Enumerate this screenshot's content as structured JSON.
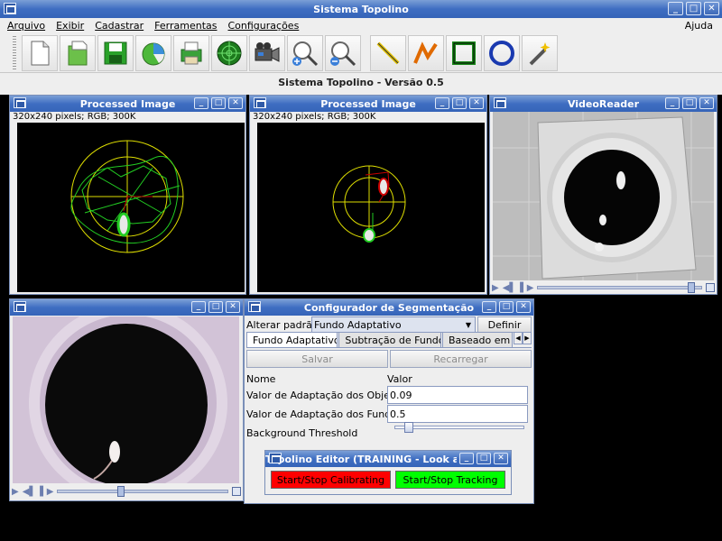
{
  "main": {
    "title": "Sistema Topolino",
    "status": "Sistema Topolino - Versão 0.5",
    "menu": [
      "Arquivo",
      "Exibir",
      "Cadastrar",
      "Ferramentas",
      "Configurações"
    ],
    "help": "Ajuda",
    "tools": [
      "new-file",
      "open-file",
      "save",
      "pie-chart",
      "printer",
      "radar",
      "video-camera",
      "zoom-in",
      "zoom-out",
      "line",
      "polyline",
      "rectangle",
      "circle",
      "magic-wand"
    ]
  },
  "frames": {
    "processed1": {
      "title": "Processed Image",
      "info": "320x240 pixels; RGB; 300K"
    },
    "processed2": {
      "title": "Processed Image",
      "info": "320x240 pixels; RGB; 300K"
    },
    "videoreader": {
      "title": "VideoReader"
    },
    "videoplayer": {
      "title": ""
    },
    "config": {
      "title": "Configurador de Segmentação",
      "change_label": "Alterar padrão:",
      "selected": "Fundo Adaptativo",
      "define": "Definir",
      "tabs": [
        "Fundo Adaptativo",
        "Subtração de Fundo",
        "Baseado em C"
      ],
      "save": "Salvar",
      "reload": "Recarregar",
      "col_name": "Nome",
      "col_value": "Valor",
      "params": [
        {
          "label": "Valor de Adaptação dos Objetos",
          "value": "0.09"
        },
        {
          "label": "Valor de Adaptação dos Fundo",
          "value": "0.5"
        }
      ],
      "threshold_label": "Background Threshold",
      "threshold_level": 0.08
    },
    "editor": {
      "title": "Topolino Editor (TRAINING - Look an",
      "calibrate": "Start/Stop Calibrating",
      "track": "Start/Stop Tracking"
    }
  },
  "colors": {
    "title_bar": "#3f6ec2",
    "calibrate_bg": "#ff0000",
    "track_bg": "#00ff00"
  },
  "video": {
    "reader_position": 0.96,
    "player_position": 0.37
  }
}
